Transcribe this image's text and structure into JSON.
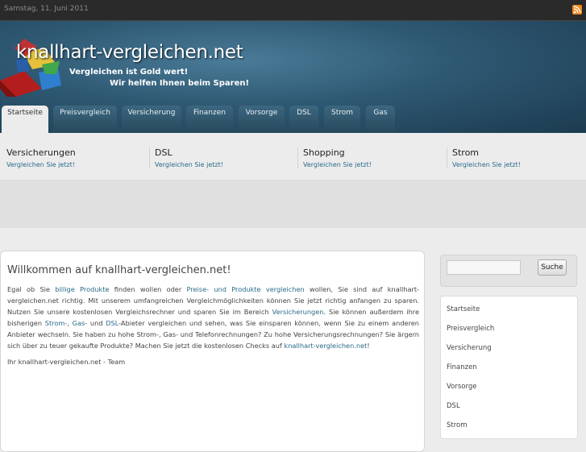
{
  "topbar": {
    "date": "Samstag, 11. Juni 2011",
    "rss_icon": "rss-feed-icon"
  },
  "header": {
    "site_title": "knallhart-vergleichen.net",
    "slogan_line1": "Vergleichen ist Gold wert!",
    "slogan_line2": "Wir helfen Ihnen beim Sparen!"
  },
  "nav": {
    "tabs": [
      {
        "label": "Startseite",
        "active": true
      },
      {
        "label": "Preisvergleich"
      },
      {
        "label": "Versicherung"
      },
      {
        "label": "Finanzen"
      },
      {
        "label": "Vorsorge"
      },
      {
        "label": "DSL"
      },
      {
        "label": "Strom"
      },
      {
        "label": "Gas"
      }
    ]
  },
  "teasers": [
    {
      "title": "Versicherungen",
      "link": "Vergleichen Sie jetzt!"
    },
    {
      "title": "DSL",
      "link": "Vergleichen Sie jetzt!"
    },
    {
      "title": "Shopping",
      "link": "Vergleichen Sie jetzt!"
    },
    {
      "title": "Strom",
      "link": "Vergleichen Sie jetzt!"
    }
  ],
  "content": {
    "heading": "Willkommen auf knallhart-vergleichen.net!",
    "p": {
      "t1": "Egal ob Sie ",
      "l1": "billige Produkte",
      "t2": " finden wollen oder ",
      "l2": "Preise- und Produkte vergleichen",
      "t3": " wollen, Sie sind auf knallhart-vergleichen.net richtig. Mit unserem umfangreichen Vergleichmöglichkeiten können Sie jetzt richtig anfangen zu sparen. Nutzen Sie unsere kostenlosen Vergleichsrechner und sparen Sie im Bereich ",
      "l3": "Versicherungen",
      "t4": ". Sie können außerdem ihre bisherigen ",
      "l4": "Strom-",
      "t5": ", ",
      "l5": "Gas",
      "t6": "- und ",
      "l6": "DSL",
      "t7": "-Abieter vergleichen und sehen, was Sie einsparen können, wenn Sie zu einem anderen Anbieter wechseln. Sie haben zu hohe Strom-, Gas- und Telefonrechnungen? Zu hohe Versicherungsrechnungen? Sie ärgern sich über zu teuer gekaufte Produkte? Machen Sie jetzt die kostenlosen Checks auf ",
      "l7": "knallhart-vergleichen.net",
      "t8": "!"
    },
    "signature": "Ihr knallhart-vergleichen.net - Team"
  },
  "sidebar": {
    "search": {
      "value": "",
      "button": "Suche"
    },
    "menu": [
      "Startseite",
      "Preisvergleich",
      "Versicherung",
      "Finanzen",
      "Vorsorge",
      "DSL",
      "Strom"
    ]
  },
  "colors": {
    "link": "#2a6b8a",
    "header_dark": "#1c3b50",
    "rss": "#f08a24"
  }
}
